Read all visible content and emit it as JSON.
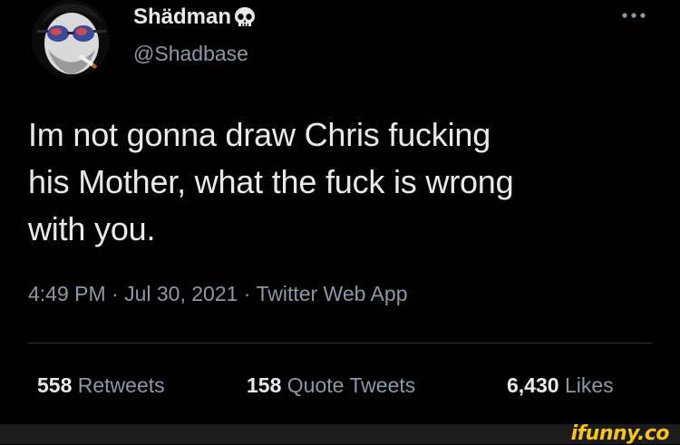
{
  "tweet": {
    "display_name": "Shädman",
    "name_emoji_icon": "skull-icon",
    "handle": "@Shadbase",
    "text": "Im not gonna draw Chris fucking\nhis Mother, what the fuck is wrong\nwith you.",
    "meta": "4:49 PM · Jul 30, 2021 · Twitter Web App",
    "stats": {
      "retweets_count": "558",
      "retweets_label": "Retweets",
      "quote_count": "158",
      "quote_label": "Quote Tweets",
      "likes_count": "6,430",
      "likes_label": "Likes"
    }
  },
  "watermark": "ifunny.co",
  "colors": {
    "background": "#000000",
    "text_primary": "#e7e9ea",
    "text_secondary": "#8b98a5",
    "divider": "#2f3336",
    "watermark": "#f5c518",
    "footer": "#1c1c1c"
  }
}
